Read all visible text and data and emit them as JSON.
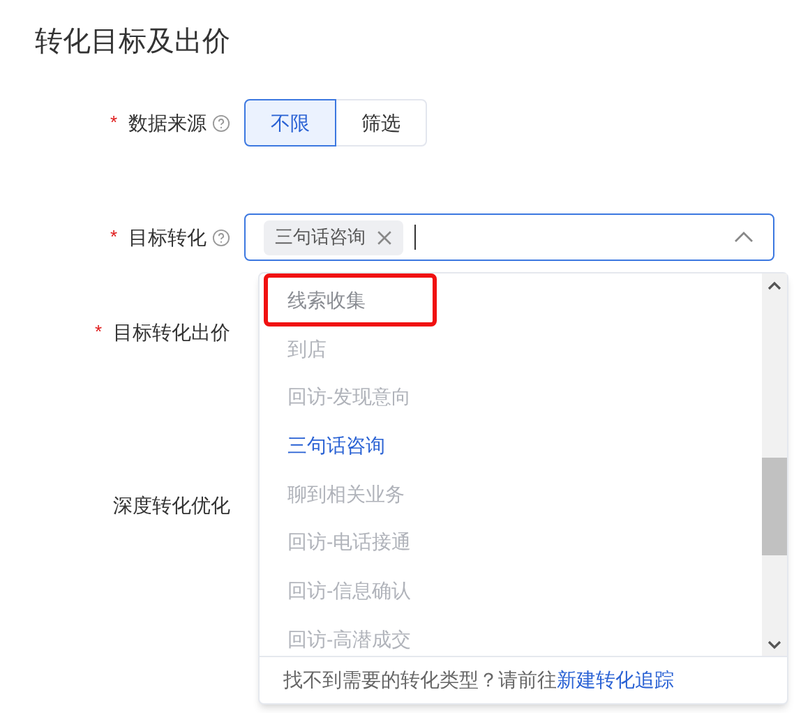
{
  "section_title": "转化目标及出价",
  "fields": [
    {
      "label": "数据来源",
      "required_mark": "*",
      "help": true,
      "kind": "segmented",
      "options": [
        {
          "label": "不限",
          "selected": true
        },
        {
          "label": "筛选",
          "selected": false
        }
      ]
    },
    {
      "label": "目标转化",
      "required_mark": "*",
      "help": true,
      "kind": "tag_select",
      "tags": [
        "三句话咨询"
      ],
      "expanded": true
    },
    {
      "label": "目标转化出价",
      "required_mark": "*",
      "help": false,
      "kind": "hidden"
    },
    {
      "label": "深度转化优化",
      "help": false,
      "kind": "hidden"
    }
  ],
  "dropdown": {
    "options": [
      {
        "label": "线索收集",
        "disabled": false,
        "selected": false,
        "highlighted": true
      },
      {
        "label": "到店",
        "disabled": true,
        "selected": false,
        "highlighted": false
      },
      {
        "label": "回访-发现意向",
        "disabled": true,
        "selected": false,
        "highlighted": false
      },
      {
        "label": "三句话咨询",
        "disabled": false,
        "selected": true,
        "highlighted": false
      },
      {
        "label": "聊到相关业务",
        "disabled": true,
        "selected": false,
        "highlighted": false
      },
      {
        "label": "回访-电话接通",
        "disabled": true,
        "selected": false,
        "highlighted": false
      },
      {
        "label": "回访-信息确认",
        "disabled": true,
        "selected": false,
        "highlighted": false
      },
      {
        "label": "回访-高潜成交",
        "disabled": true,
        "selected": false,
        "highlighted": false
      }
    ],
    "footer_text": "找不到需要的转化类型？请前往",
    "footer_link": "新建转化追踪"
  }
}
